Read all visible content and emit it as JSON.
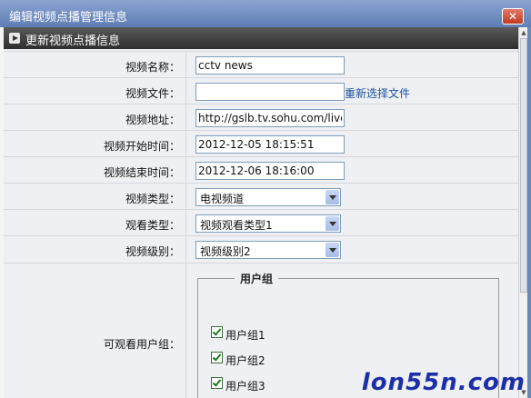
{
  "dialog": {
    "title": "编辑视频点播管理信息",
    "close_symbol": "✕",
    "section_title": "更新视频点播信息"
  },
  "form": {
    "name": {
      "label": "视频名称：",
      "value": "cctv news"
    },
    "file": {
      "label": "视频文件：",
      "value": "",
      "link": "重新选择文件"
    },
    "url": {
      "label": "视频地址：",
      "value": "http://gslb.tv.sohu.com/live?"
    },
    "start_time": {
      "label": "视频开始时间：",
      "value": "2012-12-05 18:15:51"
    },
    "end_time": {
      "label": "视频结束时间：",
      "value": "2012-12-06 18:16:00"
    },
    "type": {
      "label": "视频类型：",
      "value": "电视频道"
    },
    "watch_type": {
      "label": "观看类型：",
      "value": "视频观看类型1"
    },
    "level": {
      "label": "视频级别：",
      "value": "视频级别2"
    },
    "groups": {
      "label": "可观看用户组：",
      "legend": "用户组",
      "items": [
        {
          "label": "用户组1",
          "checked": true
        },
        {
          "label": "用户组2",
          "checked": true
        },
        {
          "label": "用户组3",
          "checked": true
        }
      ]
    }
  },
  "watermark": "lon55n.com",
  "icons": {
    "close": "close-icon",
    "section": "play-icon",
    "select_arrow": "chevron-down-icon",
    "checkbox": "checkbox-checked-icon"
  },
  "colors": {
    "titlebar": "#6f8cc0",
    "section_header": "#3a3a3a",
    "link": "#1a4fa0",
    "watermark": "#1c2fa8"
  }
}
